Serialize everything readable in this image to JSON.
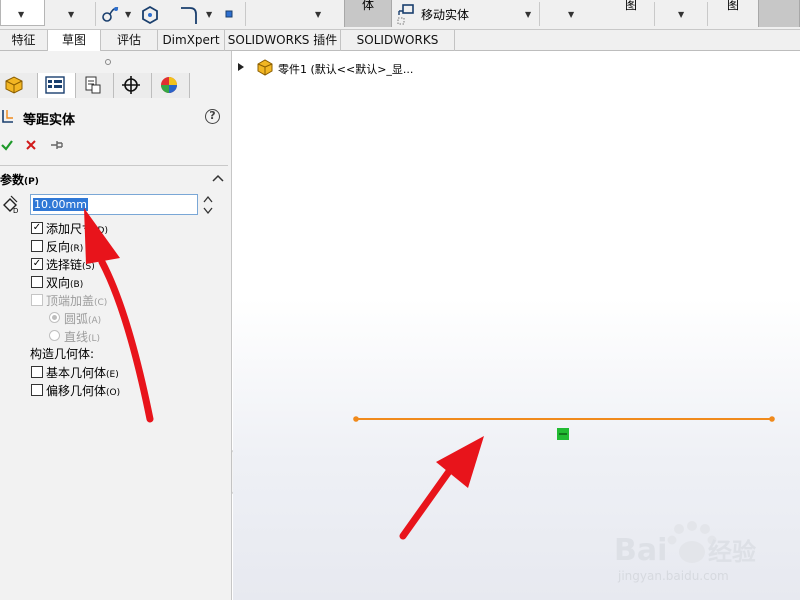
{
  "toolbar": {
    "move_entity_label": "移动实体",
    "pressed_left_label": "体",
    "pressed_right_label": "图",
    "pressed_right2_label": "图"
  },
  "tabs": [
    {
      "label": "特征"
    },
    {
      "label": "草图"
    },
    {
      "label": "评估"
    },
    {
      "label": "DimXpert"
    },
    {
      "label": "SOLIDWORKS 插件"
    },
    {
      "label": "SOLIDWORKS MBD"
    }
  ],
  "panel": {
    "title": "等距实体",
    "help_symbol": "?",
    "section_label": "参数",
    "section_key": "(P)",
    "distance_value": "10.00mm",
    "options": [
      {
        "label": "添加尺寸",
        "key": "(D)",
        "checked": true,
        "enabled": true
      },
      {
        "label": "反向",
        "key": "(R)",
        "checked": false,
        "enabled": true
      },
      {
        "label": "选择链",
        "key": "(S)",
        "checked": true,
        "enabled": true
      },
      {
        "label": "双向",
        "key": "(B)",
        "checked": false,
        "enabled": true
      },
      {
        "label": "顶端加盖",
        "key": "(C)",
        "checked": false,
        "enabled": false
      }
    ],
    "cap_types": [
      {
        "label": "圆弧",
        "key": "(A)",
        "selected": true
      },
      {
        "label": "直线",
        "key": "(L)",
        "selected": false
      }
    ],
    "construction_label": "构造几何体:",
    "construction_options": [
      {
        "label": "基本几何体",
        "key": "(E)",
        "checked": false
      },
      {
        "label": "偏移几何体",
        "key": "(O)",
        "checked": false
      }
    ]
  },
  "tree": {
    "part_label": "零件1  (默认<<默认>_显..."
  },
  "colors": {
    "sketch_line": "#f08a1c",
    "arrow": "#e8141b",
    "selection_marker": "#22bb33"
  },
  "watermark": {
    "brand": "Bai 经验",
    "url": "jingyan.baidu.com"
  }
}
